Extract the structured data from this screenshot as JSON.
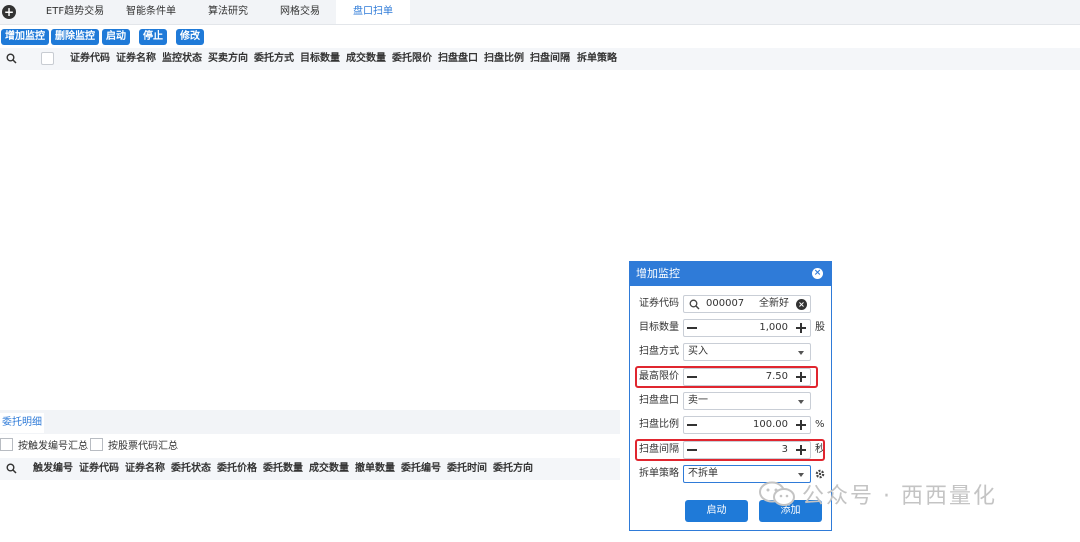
{
  "tabs": [
    {
      "label": "ETF趋势交易",
      "active": false
    },
    {
      "label": "智能条件单",
      "active": false
    },
    {
      "label": "算法研究",
      "active": false
    },
    {
      "label": "网格交易",
      "active": false
    },
    {
      "label": "盘口扫单",
      "active": true
    }
  ],
  "toolbar": {
    "add_label": "增加监控",
    "delete_label": "删除监控",
    "start_label": "启动",
    "stop_label": "停止",
    "modify_label": "修改"
  },
  "monitor_table": {
    "columns": [
      "证券代码",
      "证券名称",
      "监控状态",
      "买卖方向",
      "委托方式",
      "目标数量",
      "成交数量",
      "委托限价",
      "扫盘盘口",
      "扫盘比例",
      "扫盘间隔",
      "拆单策略"
    ]
  },
  "detail": {
    "tab_label": "委托明细",
    "group_by_trigger": "按触发编号汇总",
    "group_by_code": "按股票代码汇总",
    "columns": [
      "触发编号",
      "证券代码",
      "证券名称",
      "委托状态",
      "委托价格",
      "委托数量",
      "成交数量",
      "撤单数量",
      "委托编号",
      "委托时间",
      "委托方向"
    ]
  },
  "dialog": {
    "title": "增加监控",
    "fields": {
      "code": {
        "label": "证券代码",
        "value": "000007",
        "name": "全新好"
      },
      "quantity": {
        "label": "目标数量",
        "value": "1,000",
        "unit": "股"
      },
      "method": {
        "label": "扫盘方式",
        "value": "买入"
      },
      "max_price": {
        "label": "最高限价",
        "value": "7.50"
      },
      "level": {
        "label": "扫盘盘口",
        "value": "卖一"
      },
      "ratio": {
        "label": "扫盘比例",
        "value": "100.00",
        "unit": "%"
      },
      "interval": {
        "label": "扫盘间隔",
        "value": "3",
        "unit": "秒"
      },
      "split": {
        "label": "拆单策略",
        "value": "不拆单"
      }
    },
    "start_button": "启动",
    "add_button": "添加",
    "highlight_color": "#e0262f",
    "accent_color": "#2f7bd8"
  },
  "watermark": {
    "text": "公众号 · 西西量化"
  }
}
